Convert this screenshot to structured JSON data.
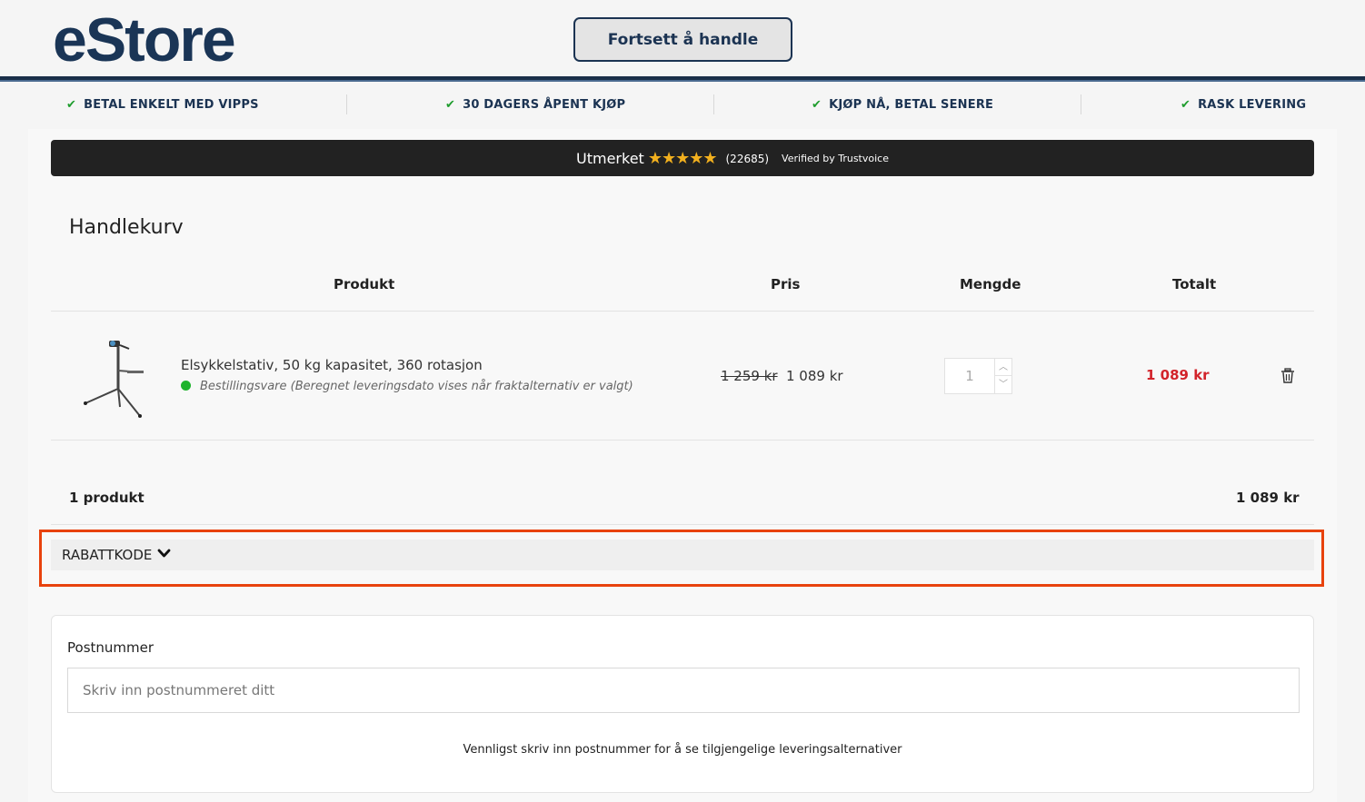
{
  "header": {
    "logo_text": "eStore",
    "continue_label": "Fortsett å handle"
  },
  "usps": [
    {
      "label": "BETAL ENKELT MED VIPPS",
      "icon": "check-icon"
    },
    {
      "label": "30 DAGERS ÅPENT KJØP",
      "icon": "check-icon"
    },
    {
      "label": "KJØP NÅ, BETAL SENERE",
      "icon": "check-icon"
    },
    {
      "label": "RASK LEVERING",
      "icon": "check-icon"
    }
  ],
  "trust": {
    "label": "Utmerket",
    "stars": "★★★★★",
    "rating_icon": "star-icon",
    "count": "(22685)",
    "verified": "Verified by Trustvoice"
  },
  "cart": {
    "title": "Handlekurv",
    "columns": {
      "product": "Produkt",
      "price": "Pris",
      "quantity": "Mengde",
      "total": "Totalt"
    },
    "items": [
      {
        "name": "Elsykkelstativ, 50 kg kapasitet, 360 rotasjon",
        "status": "Bestillingsvare (Beregnet leveringsdato vises når fraktalternativ er valgt)",
        "old_price": "1 259 kr",
        "price": "1 089 kr",
        "quantity": "1",
        "total": "1 089 kr"
      }
    ],
    "summary": {
      "count_label": "1 produkt",
      "total": "1 089 kr"
    }
  },
  "discount": {
    "label": "RABATTKODE"
  },
  "postal": {
    "label": "Postnummer",
    "placeholder": "Skriv inn postnummeret ditt",
    "value": "",
    "hint": "Vennligst skriv inn postnummer for å se tilgjengelige leveringsalternativer"
  },
  "colors": {
    "brand": "#1a3556",
    "accent_red": "#d2232a",
    "check_green": "#1f9d2e",
    "highlight": "#e8420d"
  }
}
